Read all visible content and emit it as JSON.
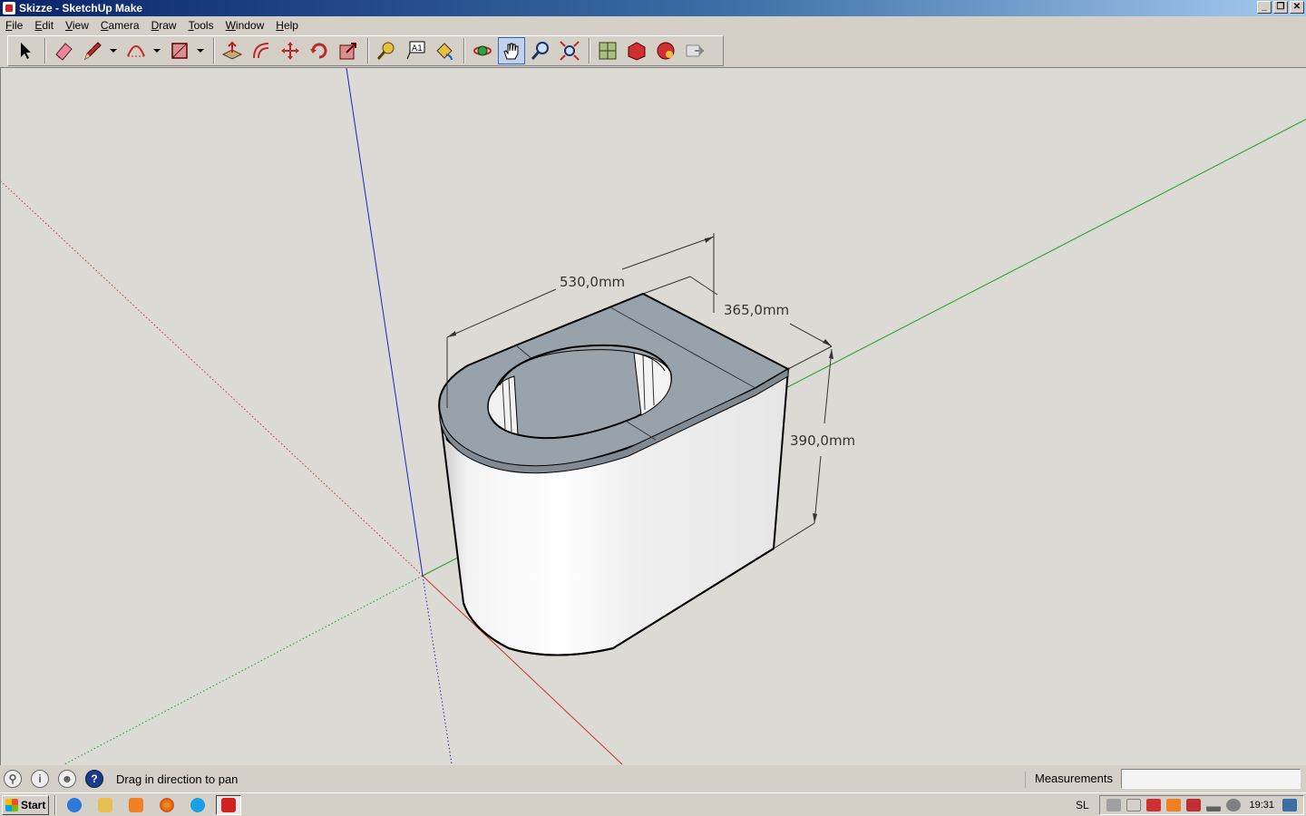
{
  "window": {
    "title": "Skizze - SketchUp Make",
    "controls": [
      "minimize",
      "restore",
      "close"
    ]
  },
  "menu": [
    "File",
    "Edit",
    "View",
    "Camera",
    "Draw",
    "Tools",
    "Window",
    "Help"
  ],
  "toolbar": {
    "tools": [
      {
        "name": "select-tool",
        "icon": "arrow-cursor-icon"
      },
      {
        "name": "eraser-tool",
        "icon": "eraser-icon"
      },
      {
        "name": "line-tool",
        "icon": "pencil-icon"
      },
      {
        "name": "arc-tool",
        "icon": "arc-icon"
      },
      {
        "name": "rectangle-tool",
        "icon": "rectangle-icon"
      },
      {
        "name": "push-pull-tool",
        "icon": "push-pull-icon"
      },
      {
        "name": "offset-tool",
        "icon": "offset-icon"
      },
      {
        "name": "move-tool",
        "icon": "move-icon"
      },
      {
        "name": "rotate-tool",
        "icon": "rotate-icon"
      },
      {
        "name": "scale-tool",
        "icon": "scale-icon"
      },
      {
        "name": "tape-measure-tool",
        "icon": "tape-measure-icon"
      },
      {
        "name": "text-tool",
        "icon": "text-icon"
      },
      {
        "name": "paint-bucket-tool",
        "icon": "paint-bucket-icon"
      },
      {
        "name": "orbit-tool",
        "icon": "orbit-icon"
      },
      {
        "name": "pan-tool",
        "icon": "hand-icon",
        "active": true
      },
      {
        "name": "zoom-tool",
        "icon": "magnifier-icon"
      },
      {
        "name": "zoom-extents-tool",
        "icon": "zoom-extents-icon"
      },
      {
        "name": "3d-warehouse",
        "icon": "warehouse-icon"
      },
      {
        "name": "share-model",
        "icon": "share-model-icon"
      },
      {
        "name": "extension-warehouse",
        "icon": "extension-icon"
      },
      {
        "name": "send-to-layout",
        "icon": "layout-icon"
      }
    ]
  },
  "model": {
    "dimensions": {
      "width": "530,0mm",
      "depth": "365,0mm",
      "height": "390,0mm"
    }
  },
  "statusbar": {
    "hint": "Drag in direction to pan",
    "measurements_label": "Measurements",
    "measurements_value": ""
  },
  "taskbar": {
    "start_label": "Start",
    "language": "SL",
    "clock": "19:31"
  },
  "colors": {
    "x_axis": "#d03030",
    "y_axis": "#20a020",
    "z_axis": "#2020c0",
    "top_face": "#97a2aa",
    "side_face": "#f0f0f0"
  }
}
